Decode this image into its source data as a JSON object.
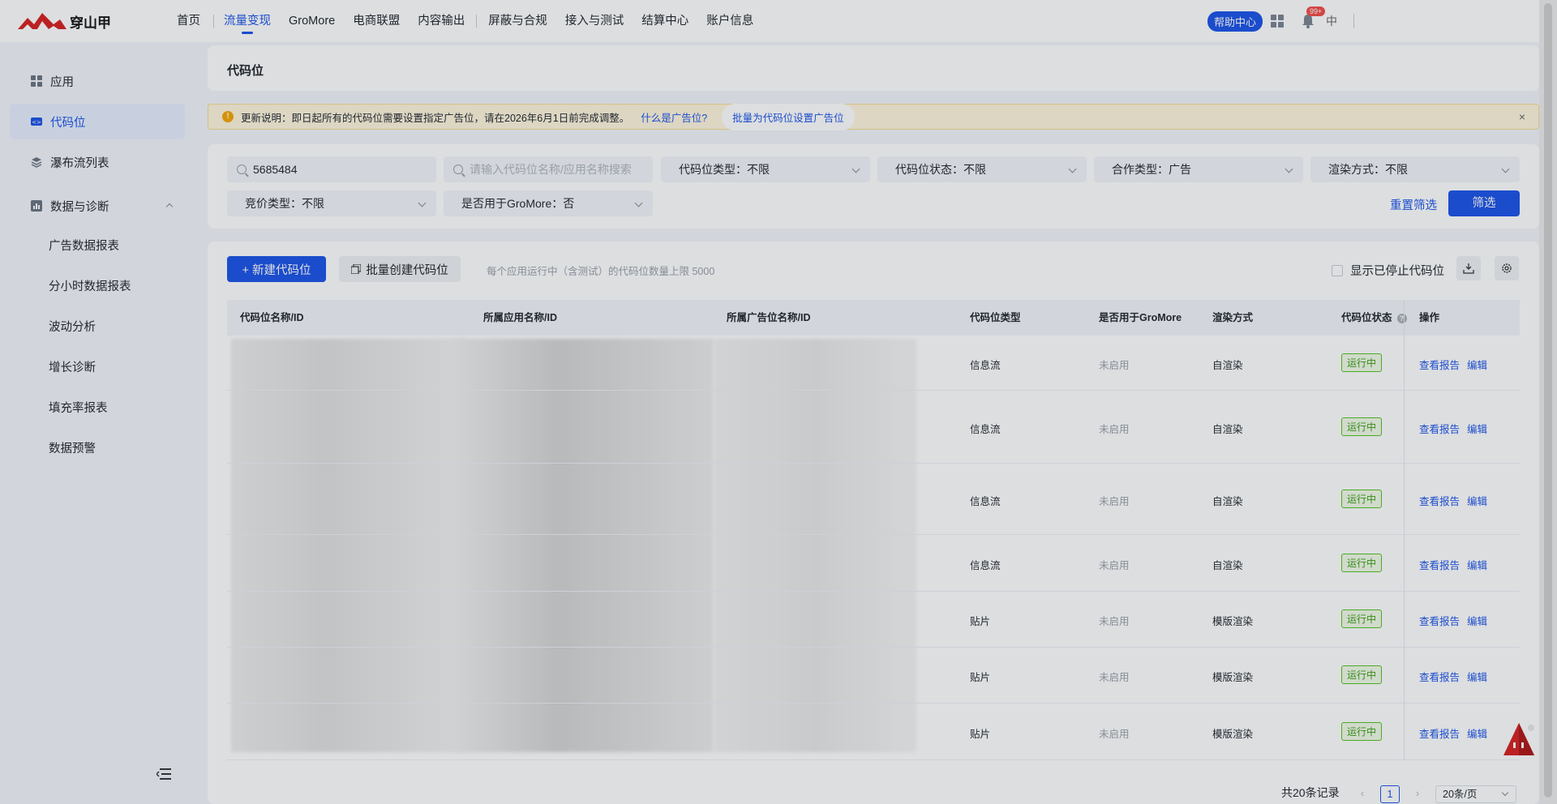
{
  "brand": {
    "name": "穿山甲"
  },
  "topnav": {
    "items": [
      "首页",
      "流量变现",
      "GroMore",
      "电商联盟",
      "内容输出",
      "屏蔽与合规",
      "接入与测试",
      "结算中心",
      "账户信息"
    ],
    "active_index": 1,
    "help_label": "帮助中心",
    "badge": "99+",
    "lang": "中"
  },
  "sidebar": {
    "items": [
      {
        "label": "应用",
        "icon": "app-grid-icon"
      },
      {
        "label": "代码位",
        "icon": "code-slot-icon"
      },
      {
        "label": "瀑布流列表",
        "icon": "layers-icon"
      },
      {
        "label": "数据与诊断",
        "icon": "data-icon"
      }
    ],
    "sub_items": [
      "广告数据报表",
      "分小时数据报表",
      "波动分析",
      "增长诊断",
      "填充率报表",
      "数据预警"
    ],
    "active_index": 1
  },
  "page": {
    "title": "代码位"
  },
  "notice": {
    "text": "更新说明：即日起所有的代码位需要设置指定广告位，请在2026年6月1日前完成调整。",
    "link": "什么是广告位?",
    "action": "批量为代码位设置广告位",
    "close": "×"
  },
  "filters": {
    "search_id_value": "5685484",
    "search_name_placeholder": "请输入代码位名称/应用名称搜索",
    "slot_type": "代码位类型：不限",
    "slot_status": "代码位状态：不限",
    "coop_type": "合作类型：广告",
    "render_mode": "渲染方式：不限",
    "bid_type": "竞价类型：不限",
    "gromore": "是否用于GroMore：否",
    "reset_label": "重置筛选",
    "filter_label": "筛选"
  },
  "toolbar": {
    "new_label": "+ 新建代码位",
    "batch_label": "批量创建代码位",
    "hint": "每个应用运行中（含测试）的代码位数量上限 5000",
    "show_stopped_label": "显示已停止代码位"
  },
  "table": {
    "headers": [
      "代码位名称/ID",
      "所属应用名称/ID",
      "所属广告位名称/ID",
      "代码位类型",
      "是否用于GroMore",
      "渲染方式",
      "代码位状态",
      "操作"
    ],
    "rows": [
      {
        "type": "信息流",
        "gromore": "未启用",
        "render": "自渲染",
        "status": "运行中",
        "op1": "查看报告",
        "op2": "编辑"
      },
      {
        "type": "信息流",
        "gromore": "未启用",
        "render": "自渲染",
        "status": "运行中",
        "op1": "查看报告",
        "op2": "编辑"
      },
      {
        "type": "信息流",
        "gromore": "未启用",
        "render": "自渲染",
        "status": "运行中",
        "op1": "查看报告",
        "op2": "编辑"
      },
      {
        "type": "信息流",
        "gromore": "未启用",
        "render": "自渲染",
        "status": "运行中",
        "op1": "查看报告",
        "op2": "编辑"
      },
      {
        "type": "贴片",
        "gromore": "未启用",
        "render": "模版渲染",
        "status": "运行中",
        "op1": "查看报告",
        "op2": "编辑"
      },
      {
        "type": "贴片",
        "gromore": "未启用",
        "render": "模版渲染",
        "status": "运行中",
        "op1": "查看报告",
        "op2": "编辑"
      },
      {
        "type": "贴片",
        "gromore": "未启用",
        "render": "模版渲染",
        "status": "运行中",
        "op1": "查看报告",
        "op2": "编辑"
      }
    ]
  },
  "pagination": {
    "total": "共20条记录",
    "current": "1",
    "page_size": "20条/页"
  },
  "colors": {
    "primary": "#1a52e8",
    "success": "#52c41a",
    "warning_bg": "#fff6dd",
    "brand_red": "#d81e1e"
  }
}
